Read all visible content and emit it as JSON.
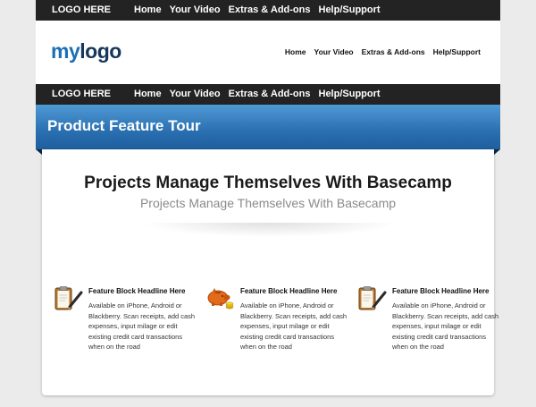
{
  "top_bar": {
    "logo": "LOGO HERE",
    "nav": [
      "Home",
      "Your Video",
      "Extras & Add-ons",
      "Help/Support"
    ]
  },
  "header": {
    "logo_part1": "my",
    "logo_part2": "logo",
    "nav": [
      "Home",
      "Your Video",
      "Extras & Add-ons",
      "Help/Support"
    ]
  },
  "second_bar": {
    "logo": "LOGO HERE",
    "nav": [
      "Home",
      "Your Video",
      "Extras & Add-ons",
      "Help/Support"
    ]
  },
  "ribbon": {
    "title": "Product Feature Tour"
  },
  "content": {
    "headline": "Projects Manage Themselves With Basecamp",
    "subheadline": "Projects Manage Themselves With Basecamp",
    "features": [
      {
        "icon": "clipboard-pen-icon",
        "title": "Feature Block Headline Here",
        "text": "Available on iPhone, Android or Blackberry. Scan receipts, add cash expenses, input milage or edit existing credit card transactions when on the road"
      },
      {
        "icon": "piggy-bank-icon",
        "title": "Feature Block Headline Here",
        "text": "Available on iPhone, Android or Blackberry. Scan receipts, add cash expenses, input milage or edit existing credit card transactions when on the road"
      },
      {
        "icon": "clipboard-pen-icon",
        "title": "Feature Block Headline Here",
        "text": "Available on iPhone, Android or Blackberry. Scan receipts, add cash expenses, input milage or edit existing credit card transactions when on the road"
      }
    ]
  },
  "colors": {
    "dark_bar": "#232323",
    "ribbon_blue": "#2a6fb0",
    "logo_blue": "#1a6fb7",
    "logo_navy": "#17365d"
  }
}
